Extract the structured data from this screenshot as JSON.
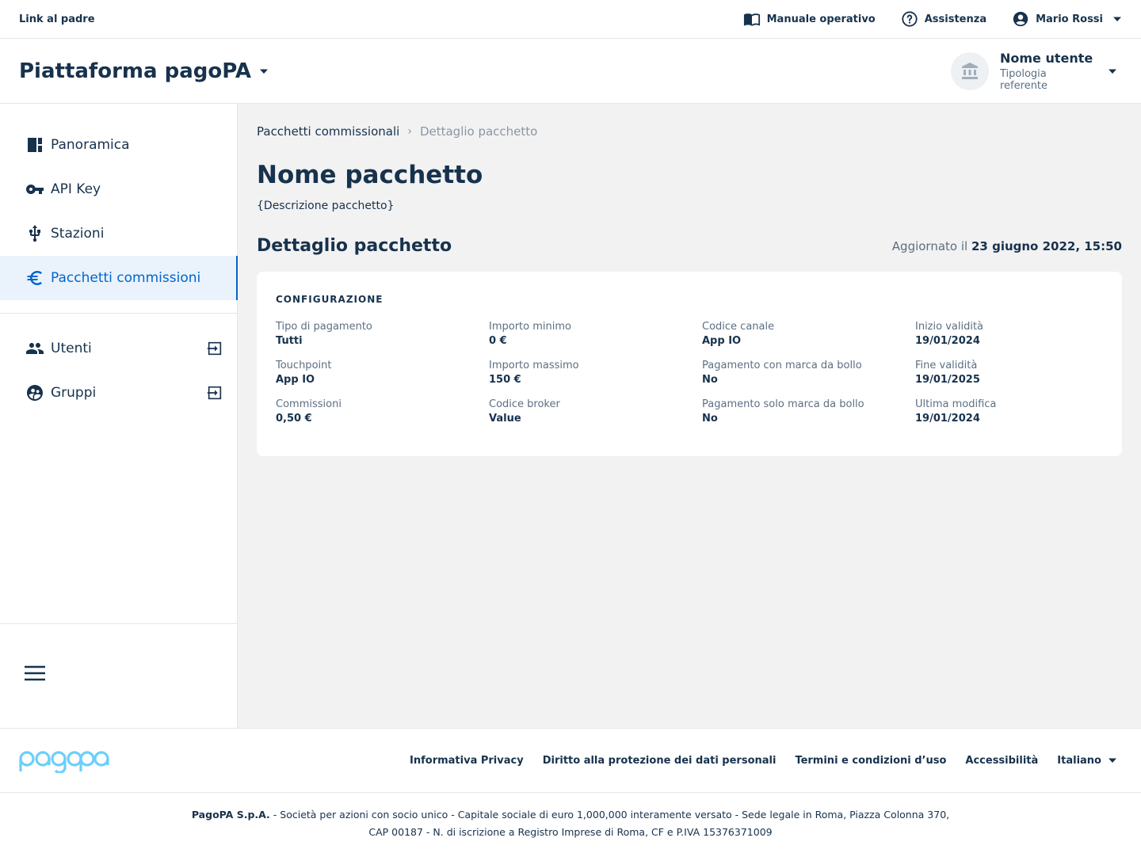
{
  "header": {
    "parent_link": "Link al padre",
    "manual": "Manuale operativo",
    "help": "Assistenza",
    "user": "Mario Rossi"
  },
  "product": {
    "name": "Piattaforma pagoPA",
    "party_name": "Nome utente",
    "party_role": "Tipologia referente"
  },
  "sidebar": {
    "items": [
      {
        "label": "Panoramica",
        "icon": "dashboard-icon"
      },
      {
        "label": "API Key",
        "icon": "key-icon"
      },
      {
        "label": "Stazioni",
        "icon": "usb-icon"
      },
      {
        "label": "Pacchetti commissioni",
        "icon": "euro-icon",
        "active": true
      }
    ],
    "external_items": [
      {
        "label": "Utenti",
        "icon": "people-icon"
      },
      {
        "label": "Gruppi",
        "icon": "group-icon"
      }
    ]
  },
  "breadcrumb": {
    "parent": "Pacchetti commissionali",
    "current": "Dettaglio pacchetto"
  },
  "page": {
    "title": "Nome pacchetto",
    "description": "{Descrizione pacchetto}",
    "section_title": "Dettaglio pacchetto",
    "updated_label": "Aggiornato il",
    "updated_value": "23 giugno 2022, 15:50"
  },
  "config": {
    "title": "CONFIGURAZIONE",
    "fields": [
      {
        "label": "Tipo di pagamento",
        "value": "Tutti"
      },
      {
        "label": "Importo minimo",
        "value": "0 €"
      },
      {
        "label": "Codice canale",
        "value": "App IO"
      },
      {
        "label": "Inizio validità",
        "value": "19/01/2024"
      },
      {
        "label": "Touchpoint",
        "value": "App IO"
      },
      {
        "label": "Importo massimo",
        "value": "150 €"
      },
      {
        "label": "Pagamento con marca da bollo",
        "value": "No"
      },
      {
        "label": "Fine validità",
        "value": "19/01/2025"
      },
      {
        "label": "Commissioni",
        "value": "0,50 €"
      },
      {
        "label": "Codice broker",
        "value": "Value"
      },
      {
        "label": "Pagamento solo marca da bollo",
        "value": "No"
      },
      {
        "label": "Ultima modifica",
        "value": "19/01/2024"
      }
    ]
  },
  "footer": {
    "logo_alt": "pagoPA",
    "links": [
      "Informativa Privacy",
      "Diritto alla protezione dei dati personali",
      "Termini e condizioni d’uso",
      "Accessibilità"
    ],
    "language": "Italiano",
    "legal_company": "PagoPA S.p.A.",
    "legal_line1": " - Società per azioni con socio unico - Capitale sociale di euro 1,000,000 interamente versato - Sede legale in Roma, Piazza Colonna 370,",
    "legal_line2": "CAP 00187 - N. di iscrizione a Registro Imprese di Roma, CF e P.IVA 15376371009"
  },
  "colors": {
    "primary": "#0066CC",
    "text": "#17324D",
    "muted": "#5C6F82",
    "background": "#F2F2F2",
    "logo": "#6BCFFB"
  }
}
